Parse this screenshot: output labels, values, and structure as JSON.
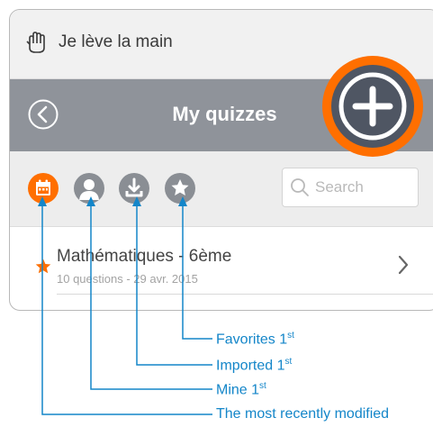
{
  "app_bar": {
    "title": "Je lève la main",
    "logo_icon": "raised-hand-icon"
  },
  "nav_bar": {
    "title": "My quizzes",
    "back_icon": "chevron-left-icon",
    "add_icon": "plus-icon"
  },
  "filters": [
    {
      "id": "recent",
      "icon": "calendar-icon",
      "active": true
    },
    {
      "id": "mine",
      "icon": "user-icon",
      "active": false
    },
    {
      "id": "imported",
      "icon": "download-icon",
      "active": false
    },
    {
      "id": "favorites",
      "icon": "star-icon",
      "active": false
    }
  ],
  "search": {
    "placeholder": "Search",
    "icon": "search-icon"
  },
  "quizzes": [
    {
      "title": "Mathématiques - 6ème",
      "meta": "10 questions - 29 avr. 2015",
      "favorite": true
    }
  ],
  "annotations": [
    {
      "text": "Favorites 1",
      "sup": "st"
    },
    {
      "text": "Imported 1",
      "sup": "st"
    },
    {
      "text": "Mine 1",
      "sup": "st"
    },
    {
      "text": "The most recently modified",
      "sup": ""
    }
  ],
  "colors": {
    "accent_orange": "#ff6f00",
    "nav_grey": "#8f939a",
    "filter_grey": "#8a8e94",
    "callout_blue": "#1486c9",
    "fab_dark": "#4f5663"
  }
}
